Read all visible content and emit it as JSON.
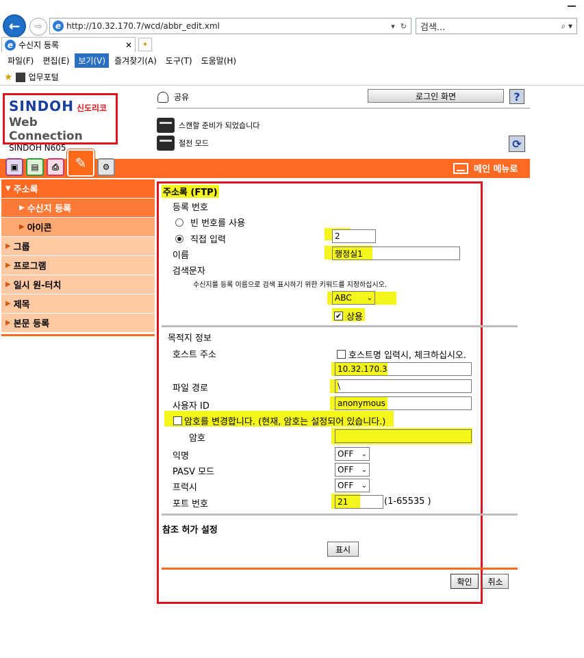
{
  "browser": {
    "url": "http://10.32.170.7/wcd/abbr_edit.xml",
    "search_placeholder": "검색...",
    "tab_title": "수신지 등록",
    "menu": [
      "파일(F)",
      "편집(E)",
      "보기(V)",
      "즐겨찾기(A)",
      "도구(T)",
      "도움말(H)"
    ],
    "active_menu_index": 2,
    "favorites": [
      "업무포털"
    ]
  },
  "header": {
    "brand": "SINDOH",
    "brand_sub": "신도리코",
    "product": "Web Connection",
    "model": "SINDOH N605",
    "user_label": "공유",
    "login_button": "로그인 화면",
    "help": "?",
    "status_scan": "스캔할 준비가 되었습니다",
    "status_power": "절전 모드",
    "main_menu_link": "메인 메뉴로"
  },
  "sidebar": {
    "items": [
      {
        "label": "주소록",
        "kind": "head"
      },
      {
        "label": "수신지 등록",
        "kind": "active"
      },
      {
        "label": "아이콘",
        "kind": "sub"
      },
      {
        "label": "그룹",
        "kind": "group"
      },
      {
        "label": "프로그램",
        "kind": "group"
      },
      {
        "label": "일시 원-터치",
        "kind": "group"
      },
      {
        "label": "제목",
        "kind": "group"
      },
      {
        "label": "본문 등록",
        "kind": "group"
      }
    ]
  },
  "form": {
    "title": "주소록 (FTP)",
    "reg_no_label": "등록 번호",
    "radio_empty": "빈 번호를 사용",
    "radio_direct": "직접 입력",
    "reg_no_value": "2",
    "name_label": "이름",
    "name_value": "행정실1",
    "search_label": "검색문자",
    "search_help": "수신지를 등록 이름으로 검색 표시하기 위한 키워드를 지정하십시오.",
    "search_select": "ABC",
    "frequent_label": "상용",
    "dest_section": "목적지 정보",
    "host_label": "호스트 주소",
    "host_check_label": "호스트명 입력시, 체크하십시오.",
    "host_value": "10.32.170.3",
    "path_label": "파일 경로",
    "path_value": "\\",
    "user_label": "사용자 ID",
    "user_value": "anonymous",
    "pw_change_label": "암호를 변경합니다. (현재, 암호는 설정되어 있습니다.)",
    "pw_label": "암호",
    "pw_value": "",
    "anon_label": "익명",
    "anon_value": "OFF",
    "pasv_label": "PASV 모드",
    "pasv_value": "OFF",
    "proxy_label": "프럭시",
    "proxy_value": "OFF",
    "port_label": "포트 번호",
    "port_value": "21",
    "port_range": "(1-65535 )",
    "ref_section": "참조 허가 설정",
    "show_button": "표시",
    "ok_button": "확인",
    "cancel_button": "취소"
  }
}
